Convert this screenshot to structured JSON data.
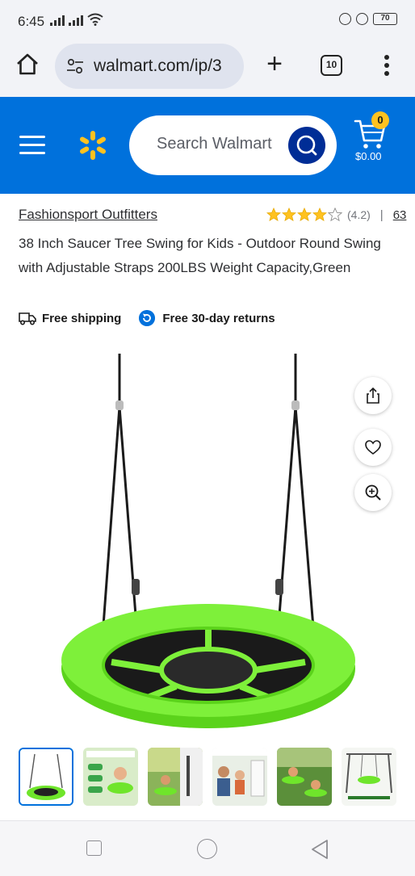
{
  "status_bar": {
    "time": "6:45",
    "battery": "70"
  },
  "browser": {
    "url": "walmart.com/ip/3",
    "tab_count": "10"
  },
  "header": {
    "search_placeholder": "Search Walmart",
    "cart_count": "0",
    "cart_total": "$0.00",
    "brand_color": "#0071dc",
    "spark_color": "#ffc220"
  },
  "product": {
    "seller": "Fashionsport Outfitters",
    "rating_value": "(4.2)",
    "rating_stars": 4.2,
    "rating_separator": "|",
    "review_count": "63",
    "title": "38 Inch Saucer Tree Swing for Kids - Outdoor Round Swing with Adjustable Straps 200LBS Weight Capacity,Green",
    "shipping_label": "Free shipping",
    "returns_label": "Free 30-day returns"
  },
  "image_actions": {
    "share_icon": "share-icon",
    "favorite_icon": "heart-icon",
    "zoom_icon": "zoom-in-icon"
  },
  "thumbnails": [
    {
      "selected": true
    },
    {
      "selected": false
    },
    {
      "selected": false
    },
    {
      "selected": false
    },
    {
      "selected": false
    },
    {
      "selected": false
    }
  ]
}
